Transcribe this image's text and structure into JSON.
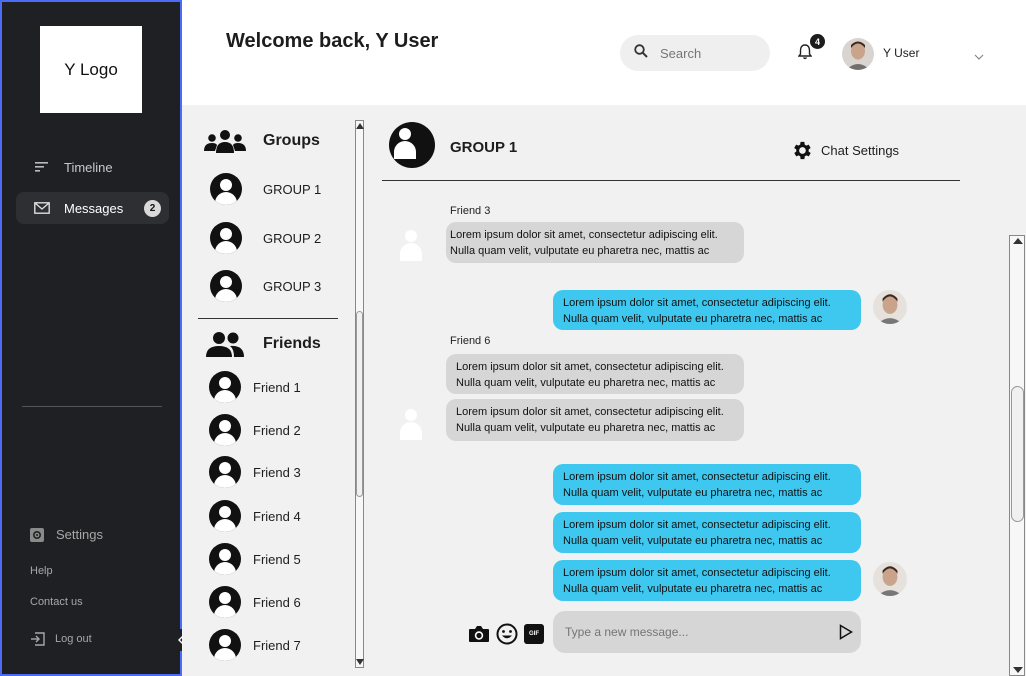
{
  "sidebar": {
    "logo_text": "Y Logo",
    "nav": [
      {
        "label": "Timeline",
        "icon": "sort-lines-icon"
      },
      {
        "label": "Messages",
        "icon": "envelope-icon",
        "badge": "2"
      }
    ],
    "settings_label": "Settings",
    "help_label": "Help",
    "contact_label": "Contact us",
    "logout_label": "Log out"
  },
  "header": {
    "welcome": "Welcome back, Y User",
    "search_placeholder": "Search",
    "notification_count": "4",
    "user_name": "Y User"
  },
  "lists": {
    "groups_title": "Groups",
    "groups": [
      "GROUP 1",
      "GROUP 2",
      "GROUP 3"
    ],
    "friends_title": "Friends",
    "friends": [
      "Friend 1",
      "Friend 2",
      "Friend 3",
      "Friend 4",
      "Friend 5",
      "Friend 6",
      "Friend 7"
    ]
  },
  "chat": {
    "title": "GROUP 1",
    "settings_label": "Chat Settings",
    "messages": [
      {
        "sender": "Friend 3",
        "line1": "Lorem ipsum dolor sit amet, consectetur adipiscing elit.",
        "line2": "Nulla quam velit, vulputate eu pharetra nec, mattis ac"
      },
      {
        "line1": "Lorem ipsum dolor sit amet, consectetur adipiscing elit.",
        "line2": "Nulla quam velit, vulputate eu pharetra nec, mattis ac"
      },
      {
        "sender": "Friend 6",
        "line1": "Lorem ipsum dolor sit amet, consectetur adipiscing elit.",
        "line2": "Nulla quam velit, vulputate eu pharetra nec, mattis ac"
      },
      {
        "line1": "Lorem ipsum dolor sit amet, consectetur adipiscing elit.",
        "line2": "Nulla quam velit, vulputate eu pharetra nec, mattis ac"
      },
      {
        "line1": "Lorem ipsum dolor sit amet, consectetur adipiscing elit.",
        "line2": "Nulla quam velit, vulputate eu pharetra nec, mattis ac"
      },
      {
        "line1": "Lorem ipsum dolor sit amet, consectetur adipiscing elit.",
        "line2": "Nulla quam velit, vulputate eu pharetra nec, mattis ac"
      },
      {
        "line1": "Lorem ipsum dolor sit amet, consectetur adipiscing elit.",
        "line2": "Nulla quam velit, vulputate eu pharetra nec, mattis ac"
      }
    ],
    "composer_placeholder": "Type a new message...",
    "gif_label": "GIF"
  },
  "colors": {
    "sidebar_bg": "#1f2023",
    "outgoing_bubble": "#3ec8f0",
    "incoming_bubble": "#d6d6d6",
    "content_bg": "#f1f1f1"
  }
}
